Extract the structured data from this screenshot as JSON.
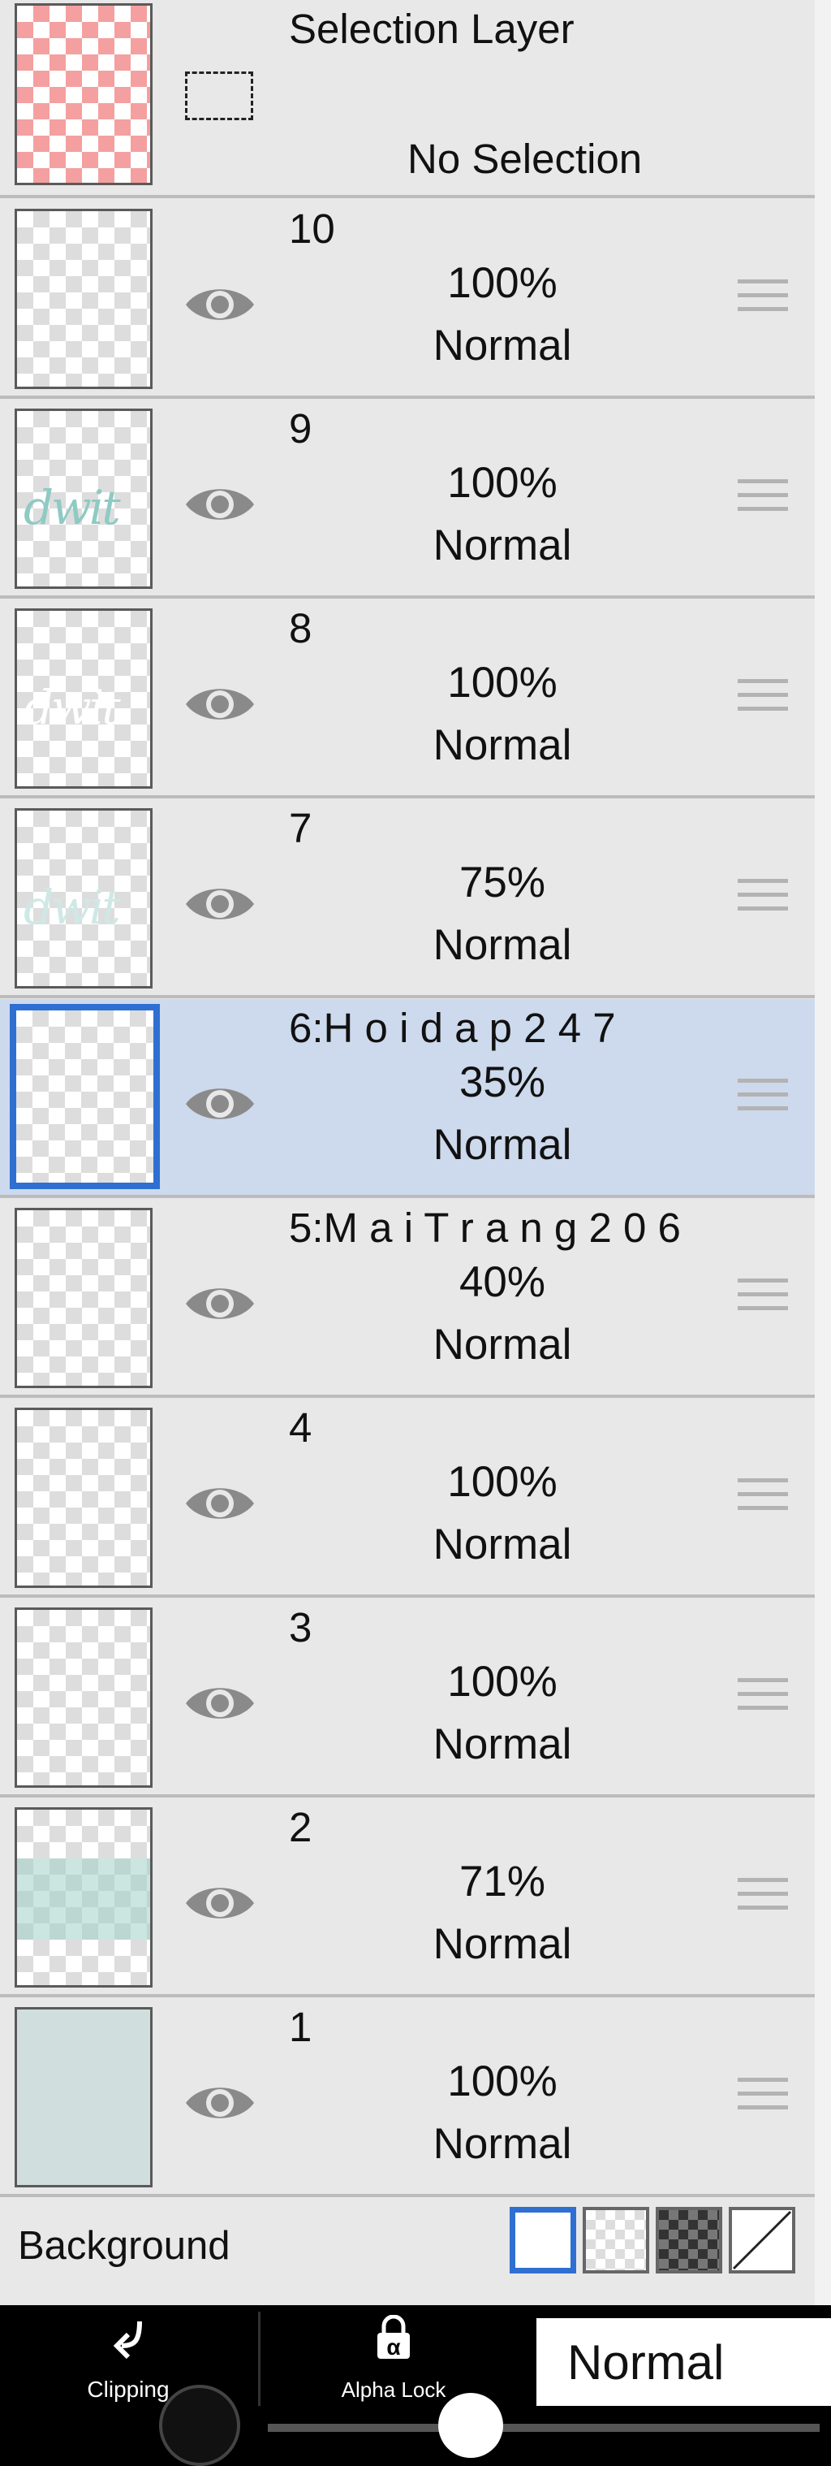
{
  "selection_layer": {
    "title": "Selection Layer",
    "status": "No Selection"
  },
  "layers": [
    {
      "name": "10",
      "opacity": "100%",
      "mode": "Normal"
    },
    {
      "name": "9",
      "opacity": "100%",
      "mode": "Normal",
      "thumb_text": "dwit"
    },
    {
      "name": "8",
      "opacity": "100%",
      "mode": "Normal",
      "thumb_text": "dwit"
    },
    {
      "name": "7",
      "opacity": "75%",
      "mode": "Normal",
      "thumb_text": "dwit"
    },
    {
      "name": "6:H o i d a p 2 4 7",
      "opacity": "35%",
      "mode": "Normal",
      "selected": true
    },
    {
      "name": "5:M a i T r a n g 2 0 6",
      "opacity": "40%",
      "mode": "Normal"
    },
    {
      "name": "4",
      "opacity": "100%",
      "mode": "Normal"
    },
    {
      "name": "3",
      "opacity": "100%",
      "mode": "Normal"
    },
    {
      "name": "2",
      "opacity": "71%",
      "mode": "Normal"
    },
    {
      "name": "1",
      "opacity": "100%",
      "mode": "Normal"
    }
  ],
  "background": {
    "label": "Background",
    "options": [
      "white",
      "transparent",
      "dark-checker",
      "none"
    ],
    "selected": "white"
  },
  "toolbar": {
    "clipping_label": "Clipping",
    "alpha_lock_label": "Alpha Lock",
    "alpha_lock_glyph": "α",
    "blend_mode": "Normal"
  },
  "colors": {
    "selection_highlight": "#cdd9ec",
    "selection_border": "#2f6fd1",
    "panel_bg": "#e8e8e8",
    "teal": "#a0d2c8"
  }
}
